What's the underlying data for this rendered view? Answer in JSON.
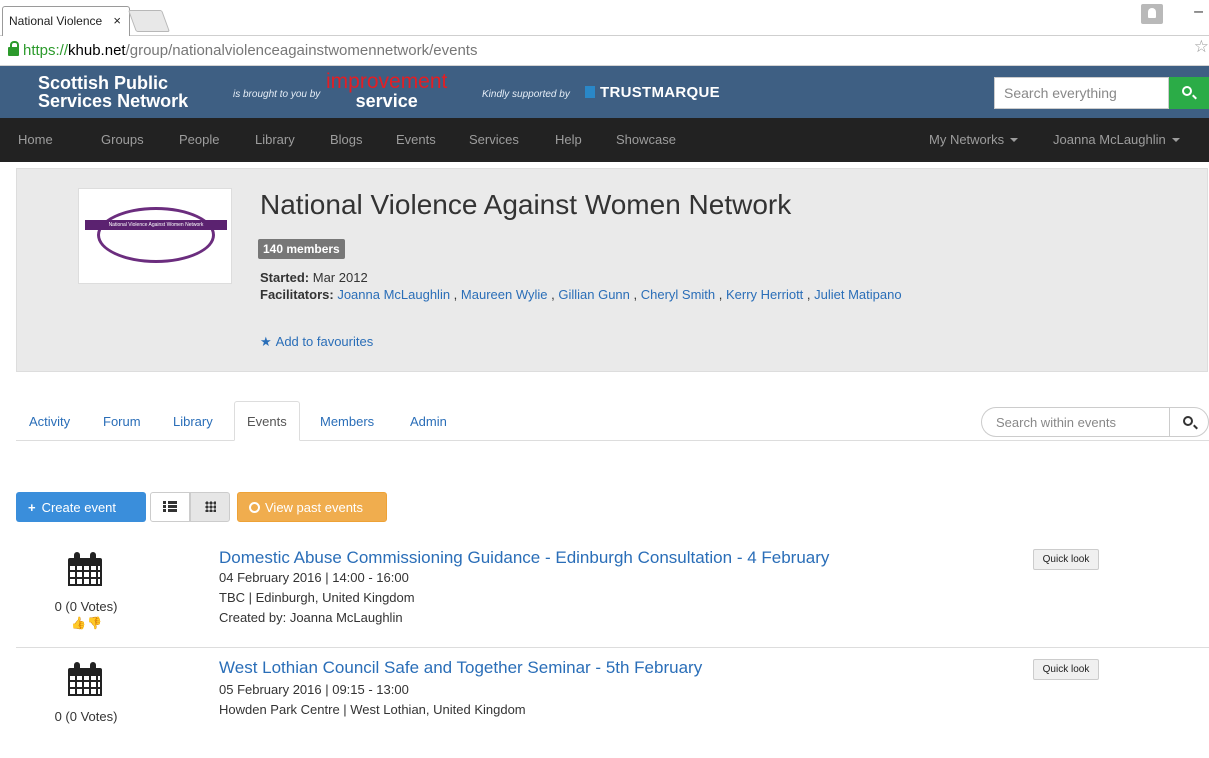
{
  "browser": {
    "tab_title": "National Violence",
    "tab_close": "×",
    "url_scheme": "https://",
    "url_host": "khub.net",
    "url_path": "/group/nationalviolenceagainstwomennetwork/events"
  },
  "header": {
    "brand": "Scottish Public Services Network",
    "brought_by": "is brought to you by",
    "improvement_line1": "improvement",
    "improvement_line2": "service",
    "kindly": "Kindly supported by",
    "trustmarque": "TRUSTMARQUE",
    "search_placeholder": "Search everything"
  },
  "nav": {
    "items": [
      "Home",
      "Groups",
      "People",
      "Library",
      "Blogs",
      "Events",
      "Services",
      "Help",
      "Showcase"
    ],
    "my_networks": "My Networks",
    "user": "Joanna McLaughlin"
  },
  "group": {
    "logo_text": "National Violence Against Women Network",
    "title": "National Violence Against Women Network",
    "members": "140 members",
    "started_label": "Started:",
    "started_value": "Mar 2012",
    "facilitators_label": "Facilitators:",
    "facilitators": [
      "Joanna McLaughlin",
      "Maureen Wylie",
      "Gillian Gunn",
      "Cheryl Smith",
      "Kerry Herriott",
      "Juliet Matipano"
    ],
    "favourite": "Add to favourites"
  },
  "tabs": {
    "items": [
      "Activity",
      "Forum",
      "Library",
      "Events",
      "Members",
      "Admin"
    ],
    "active": "Events",
    "search_placeholder": "Search within events"
  },
  "toolbar": {
    "create": "Create event",
    "past": "View past events"
  },
  "events": [
    {
      "title": "Domestic Abuse Commissioning Guidance - Edinburgh Consultation - 4 February",
      "datetime": "04 February 2016  |  14:00  -  16:00",
      "location": "TBC | Edinburgh, United Kingdom",
      "created": "Created by: Joanna McLaughlin",
      "votes": "0 (0 Votes)",
      "quick": "Quick look"
    },
    {
      "title": "West Lothian Council Safe and Together Seminar - 5th February",
      "datetime": "05 February 2016  |  09:15  -  13:00",
      "location": "Howden Park Centre | West Lothian, United Kingdom",
      "votes": "0 (0 Votes)",
      "quick": "Quick look"
    }
  ],
  "colors": {
    "header_bg": "#3e5f83",
    "navbar_bg": "#222222",
    "link": "#2a6eb8",
    "create_btn": "#3a8edb",
    "past_btn": "#f0ad4e",
    "search_btn": "#2bac47"
  }
}
